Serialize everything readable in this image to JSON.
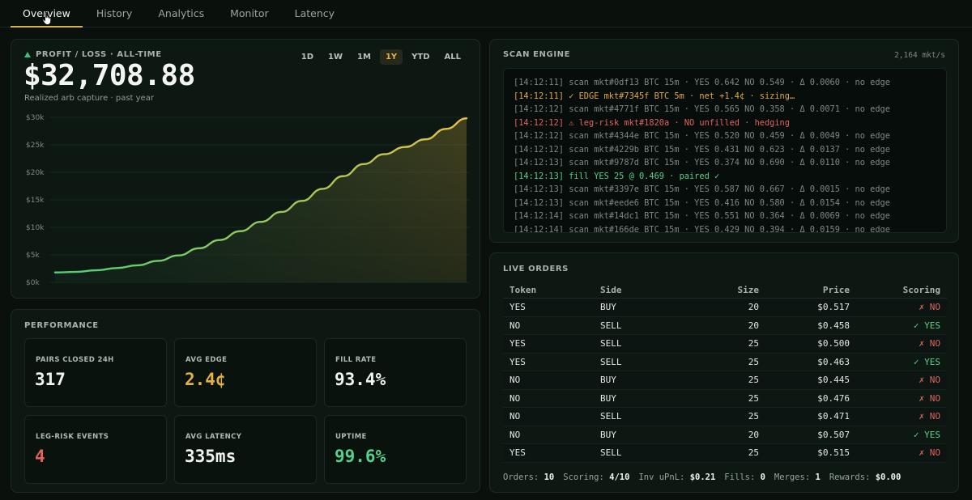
{
  "nav": {
    "tabs": [
      {
        "label": "Overview",
        "active": true
      },
      {
        "label": "History",
        "active": false
      },
      {
        "label": "Analytics",
        "active": false
      },
      {
        "label": "Monitor",
        "active": false
      },
      {
        "label": "Latency",
        "active": false
      }
    ]
  },
  "pnl": {
    "label": "PROFIT / LOSS · ALL-TIME",
    "value": "$32,708.88",
    "subtitle": "Realized arb capture · past year",
    "ranges": [
      "1D",
      "1W",
      "1M",
      "1Y",
      "YTD",
      "ALL"
    ],
    "active_range": "1Y"
  },
  "chart_data": {
    "type": "area",
    "title": "",
    "xlabel": "",
    "ylabel": "",
    "ylim": [
      0,
      30000
    ],
    "yticks": [
      "$0k",
      "$5k",
      "$10k",
      "$15k",
      "$20k",
      "$25k",
      "$30k"
    ],
    "grid": true,
    "x": [
      0,
      0.05,
      0.1,
      0.15,
      0.2,
      0.25,
      0.3,
      0.35,
      0.4,
      0.45,
      0.5,
      0.55,
      0.6,
      0.65,
      0.7,
      0.75,
      0.8,
      0.85,
      0.9,
      0.95,
      1.0
    ],
    "series": [
      {
        "values": [
          1800,
          1900,
          2200,
          2600,
          3100,
          3900,
          4900,
          6200,
          7700,
          9300,
          11000,
          12800,
          14800,
          17000,
          19300,
          21500,
          23300,
          24600,
          26000,
          27900,
          29800
        ]
      }
    ]
  },
  "performance": {
    "title": "PERFORMANCE",
    "stats": [
      {
        "label": "PAIRS CLOSED 24H",
        "value": "317",
        "color": "#f0f3f1"
      },
      {
        "label": "AVG EDGE",
        "value": "2.4¢",
        "color": "#e3b341"
      },
      {
        "label": "FILL RATE",
        "value": "93.4%",
        "color": "#f0f3f1"
      },
      {
        "label": "LEG-RISK EVENTS",
        "value": "4",
        "color": "#e2625a"
      },
      {
        "label": "AVG LATENCY",
        "value": "335ms",
        "color": "#f0f3f1"
      },
      {
        "label": "UPTIME",
        "value": "99.6%",
        "color": "#55d18c"
      }
    ]
  },
  "scan": {
    "title": "SCAN ENGINE",
    "rate": "2,164 mkt/s",
    "lines": [
      {
        "text": "[14:12:11] scan mkt#0df13 BTC 15m · YES 0.642 NO 0.549 · Δ 0.0060 · no edge",
        "kind": "scan"
      },
      {
        "text": "[14:12:11] ✓ EDGE mkt#7345f BTC 5m · net +1.4¢ · sizing…",
        "kind": "edge"
      },
      {
        "text": "[14:12:12] scan mkt#4771f BTC 15m · YES 0.565 NO 0.358 · Δ 0.0071 · no edge",
        "kind": "scan"
      },
      {
        "text": "[14:12:12] ⚠ leg-risk mkt#1820a · NO unfilled · hedging",
        "kind": "risk"
      },
      {
        "text": "[14:12:12] scan mkt#4344e BTC 15m · YES 0.520 NO 0.459 · Δ 0.0049 · no edge",
        "kind": "scan"
      },
      {
        "text": "[14:12:12] scan mkt#4229b BTC 15m · YES 0.431 NO 0.623 · Δ 0.0137 · no edge",
        "kind": "scan"
      },
      {
        "text": "[14:12:13] scan mkt#9787d BTC 15m · YES 0.374 NO 0.690 · Δ 0.0110 · no edge",
        "kind": "scan"
      },
      {
        "text": "[14:12:13] fill YES 25 @ 0.469 · paired ✓",
        "kind": "fill"
      },
      {
        "text": "[14:12:13] scan mkt#3397e BTC 15m · YES 0.587 NO 0.667 · Δ 0.0015 · no edge",
        "kind": "scan"
      },
      {
        "text": "[14:12:13] scan mkt#eede6 BTC 15m · YES 0.416 NO 0.580 · Δ 0.0154 · no edge",
        "kind": "scan"
      },
      {
        "text": "[14:12:14] scan mkt#14dc1 BTC 15m · YES 0.551 NO 0.364 · Δ 0.0069 · no edge",
        "kind": "scan"
      },
      {
        "text": "[14:12:14] scan mkt#166de BTC 15m · YES 0.429 NO 0.394 · Δ 0.0159 · no edge",
        "kind": "scan"
      }
    ]
  },
  "orders": {
    "title": "LIVE ORDERS",
    "columns": [
      "Token",
      "Side",
      "Size",
      "Price",
      "Scoring"
    ],
    "rows": [
      {
        "token": "YES",
        "side": "BUY",
        "size": "20",
        "price": "$0.517",
        "scoring": "✗ NO",
        "ok": false
      },
      {
        "token": "NO",
        "side": "SELL",
        "size": "20",
        "price": "$0.458",
        "scoring": "✓ YES",
        "ok": true
      },
      {
        "token": "YES",
        "side": "SELL",
        "size": "25",
        "price": "$0.500",
        "scoring": "✗ NO",
        "ok": false
      },
      {
        "token": "YES",
        "side": "SELL",
        "size": "25",
        "price": "$0.463",
        "scoring": "✓ YES",
        "ok": true
      },
      {
        "token": "NO",
        "side": "BUY",
        "size": "25",
        "price": "$0.445",
        "scoring": "✗ NO",
        "ok": false
      },
      {
        "token": "NO",
        "side": "BUY",
        "size": "25",
        "price": "$0.476",
        "scoring": "✗ NO",
        "ok": false
      },
      {
        "token": "NO",
        "side": "SELL",
        "size": "25",
        "price": "$0.471",
        "scoring": "✗ NO",
        "ok": false
      },
      {
        "token": "NO",
        "side": "BUY",
        "size": "20",
        "price": "$0.507",
        "scoring": "✓ YES",
        "ok": true
      },
      {
        "token": "YES",
        "side": "SELL",
        "size": "25",
        "price": "$0.515",
        "scoring": "✗ NO",
        "ok": false
      }
    ],
    "footer": [
      {
        "label": "Orders:",
        "value": "10"
      },
      {
        "label": "Scoring:",
        "value": "4/10"
      },
      {
        "label": "Inv uPnL:",
        "value": "$0.21"
      },
      {
        "label": "Fills:",
        "value": "0"
      },
      {
        "label": "Merges:",
        "value": "1"
      },
      {
        "label": "Rewards:",
        "value": "$0.00"
      }
    ]
  },
  "colors": {
    "accent": "#d8b24a",
    "positive": "#55d18c",
    "negative": "#e2625a"
  },
  "icons": {
    "cursor": "hand-pointer-icon",
    "pnl_marker": "triangle-up-icon"
  }
}
